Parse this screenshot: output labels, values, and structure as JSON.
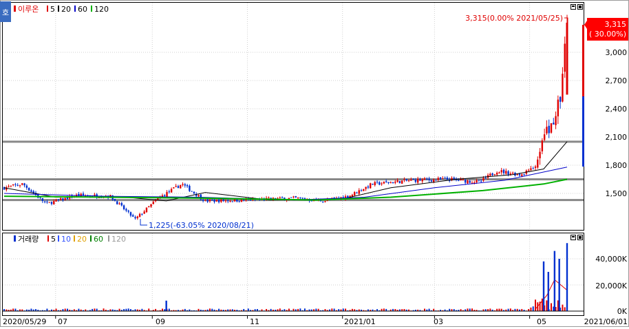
{
  "price_legend": {
    "stock": "이루온",
    "ma": [
      {
        "label": "5",
        "color": "#e00000"
      },
      {
        "label": "20",
        "color": "#000000"
      },
      {
        "label": "60",
        "color": "#0000c8"
      },
      {
        "label": "120",
        "color": "#00b000"
      }
    ]
  },
  "volume_legend": {
    "label": "거래량",
    "ma": [
      {
        "label": "5",
        "color": "#e00000"
      },
      {
        "label": "10",
        "color": "#3050ff"
      },
      {
        "label": "20",
        "color": "#e0a000"
      },
      {
        "label": "60",
        "color": "#008000"
      },
      {
        "label": "120",
        "color": "#999999"
      }
    ]
  },
  "corner_tab": "호",
  "price_badge": {
    "price": "3,315",
    "pct": "( 30.00%)"
  },
  "annotations": {
    "high": "3,315(0.00% 2021/05/25)",
    "low": "1,225(-63.05% 2020/08/21)"
  },
  "price_axis": {
    "ticks": [
      "3,000",
      "2,700",
      "2,400",
      "2,100",
      "1,800",
      "1,500"
    ]
  },
  "volume_axis": {
    "ticks": [
      "40,000K",
      "20,000K",
      "0K"
    ]
  },
  "x_axis": {
    "start": "2020/05/29",
    "end": "2021/06/01",
    "ticks": [
      "07",
      "09",
      "11",
      "2021/01",
      "03",
      "05"
    ]
  },
  "colors": {
    "up": "#e00000",
    "down": "#0030d0",
    "grid": "#cfcfcf",
    "hline": "#888888"
  },
  "chart_data": {
    "type": "candlestick",
    "price_ylim": [
      1225,
      3315
    ],
    "volume_ylim": [
      0,
      52000
    ],
    "horizontal_lines": [
      2050,
      1650,
      1430
    ],
    "anchors": [
      {
        "date": "2020/05/29",
        "price": 1560
      },
      {
        "date": "2020/06/10",
        "price": 1600
      },
      {
        "date": "2020/06/25",
        "price": 1390
      },
      {
        "date": "2020/07/15",
        "price": 1480
      },
      {
        "date": "2020/08/05",
        "price": 1470
      },
      {
        "date": "2020/08/21",
        "price": 1225
      },
      {
        "date": "2020/09/05",
        "price": 1450
      },
      {
        "date": "2020/09/20",
        "price": 1600
      },
      {
        "date": "2020/10/05",
        "price": 1420
      },
      {
        "date": "2020/11/01",
        "price": 1430
      },
      {
        "date": "2020/12/01",
        "price": 1450
      },
      {
        "date": "2020/12/20",
        "price": 1420
      },
      {
        "date": "2021/01/05",
        "price": 1470
      },
      {
        "date": "2021/01/20",
        "price": 1600
      },
      {
        "date": "2021/02/15",
        "price": 1640
      },
      {
        "date": "2021/03/10",
        "price": 1650
      },
      {
        "date": "2021/03/30",
        "price": 1620
      },
      {
        "date": "2021/04/10",
        "price": 1740
      },
      {
        "date": "2021/04/25",
        "price": 1700
      },
      {
        "date": "2021/05/05",
        "price": 1800
      },
      {
        "date": "2021/05/10",
        "price": 2100
      },
      {
        "date": "2021/05/17",
        "price": 2300
      },
      {
        "date": "2021/05/21",
        "price": 2550
      },
      {
        "date": "2021/05/25",
        "price": 3315
      }
    ],
    "moving_averages": [
      {
        "name": "20",
        "color": "#000000",
        "points": [
          {
            "date": "2020/05/29",
            "price": 1560
          },
          {
            "date": "2020/07/01",
            "price": 1460
          },
          {
            "date": "2020/08/15",
            "price": 1460
          },
          {
            "date": "2020/09/10",
            "price": 1420
          },
          {
            "date": "2020/10/05",
            "price": 1510
          },
          {
            "date": "2020/11/15",
            "price": 1430
          },
          {
            "date": "2021/01/01",
            "price": 1440
          },
          {
            "date": "2021/02/01",
            "price": 1560
          },
          {
            "date": "2021/03/15",
            "price": 1650
          },
          {
            "date": "2021/04/20",
            "price": 1700
          },
          {
            "date": "2021/05/10",
            "price": 1760
          },
          {
            "date": "2021/05/25",
            "price": 2050
          }
        ]
      },
      {
        "name": "60",
        "color": "#0000c8",
        "points": [
          {
            "date": "2020/05/29",
            "price": 1500
          },
          {
            "date": "2020/08/01",
            "price": 1470
          },
          {
            "date": "2020/10/01",
            "price": 1460
          },
          {
            "date": "2020/12/01",
            "price": 1430
          },
          {
            "date": "2021/01/15",
            "price": 1460
          },
          {
            "date": "2021/03/01",
            "price": 1560
          },
          {
            "date": "2021/04/15",
            "price": 1640
          },
          {
            "date": "2021/05/25",
            "price": 1780
          }
        ]
      },
      {
        "name": "120",
        "color": "#00b000",
        "points": [
          {
            "date": "2020/05/29",
            "price": 1470
          },
          {
            "date": "2020/08/01",
            "price": 1460
          },
          {
            "date": "2020/10/01",
            "price": 1450
          },
          {
            "date": "2020/12/15",
            "price": 1430
          },
          {
            "date": "2021/02/01",
            "price": 1460
          },
          {
            "date": "2021/04/01",
            "price": 1530
          },
          {
            "date": "2021/05/10",
            "price": 1600
          },
          {
            "date": "2021/05/25",
            "price": 1650
          }
        ]
      }
    ],
    "volume_spikes": [
      {
        "date": "2020/09/10",
        "value": 8000
      },
      {
        "date": "2021/05/10",
        "value": 38000
      },
      {
        "date": "2021/05/13",
        "value": 30000
      },
      {
        "date": "2021/05/17",
        "value": 46000
      },
      {
        "date": "2021/05/20",
        "value": 40000
      },
      {
        "date": "2021/05/25",
        "value": 52000
      }
    ]
  }
}
